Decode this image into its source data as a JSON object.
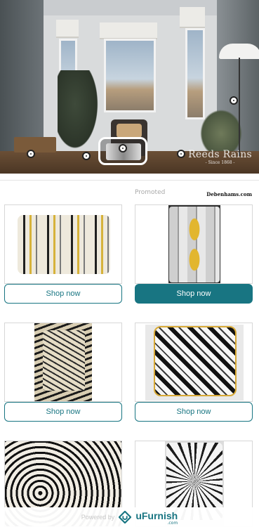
{
  "hero": {
    "brand_logo": "Reeds Rains",
    "brand_since": "- Since 1868 -",
    "hotspots": 5
  },
  "promo": {
    "promoted_label": "Promoted",
    "brand_label": "Debenhams.com"
  },
  "products": [
    {
      "button": "Shop now",
      "style": "outline"
    },
    {
      "button": "Shop now",
      "style": "filled"
    },
    {
      "button": "Shop now",
      "style": "outline"
    },
    {
      "button": "Shop now",
      "style": "outline"
    }
  ],
  "footer": {
    "powered_by": "Powered by",
    "logo_text": "uFurnish",
    "logo_suffix": ".com"
  },
  "colors": {
    "accent": "#187582",
    "text_muted": "#a9a9a9"
  }
}
